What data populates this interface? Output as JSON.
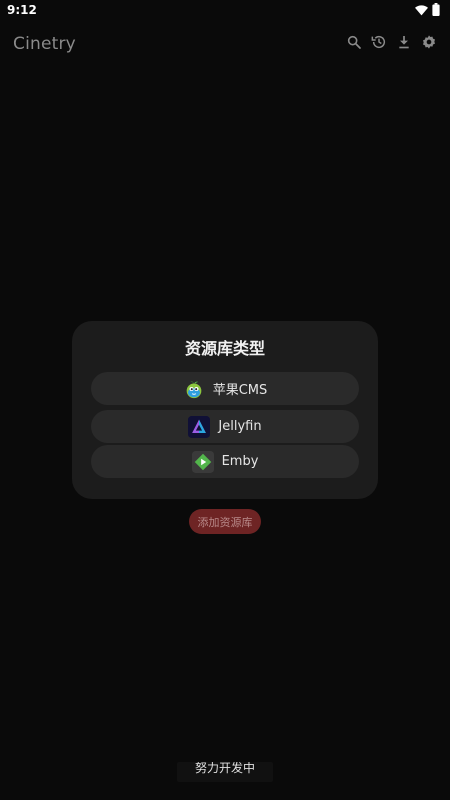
{
  "status_bar": {
    "time": "9:12",
    "icons": [
      "wifi-icon",
      "battery-icon"
    ]
  },
  "app_bar": {
    "title": "Cinetry",
    "actions": [
      "search-icon",
      "history-icon",
      "download-icon",
      "settings-icon"
    ]
  },
  "empty_state": {
    "add_button_label": "添加资源库"
  },
  "dialog": {
    "title": "资源库类型",
    "options": [
      {
        "label": "苹果CMS",
        "icon": "apple-cms-icon"
      },
      {
        "label": "Jellyfin",
        "icon": "jellyfin-icon"
      },
      {
        "label": "Emby",
        "icon": "emby-icon"
      }
    ]
  },
  "toast": {
    "text": "努力开发中"
  },
  "colors": {
    "background": "#0a0a0a",
    "dialog": "#1c1c1c",
    "option": "#2a2a2a",
    "accent_button": "#6e2424"
  }
}
